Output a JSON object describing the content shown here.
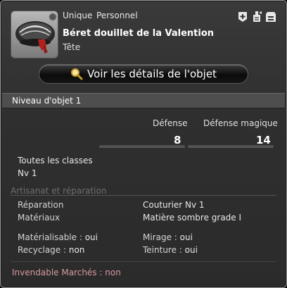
{
  "header": {
    "rarity": "Unique",
    "binding": "Personnel",
    "item_name": "Béret douillet de la Valention",
    "slot": "Tête",
    "top_icons": [
      "plus-icon",
      "crest-icon",
      "storage-icon"
    ]
  },
  "details_button": {
    "label": "Voir les détails de l'objet",
    "icon": "magnifier-icon"
  },
  "item_level": "Niveau d'objet 1",
  "stats": [
    {
      "label": "Défense",
      "value": "8"
    },
    {
      "label": "Défense magique",
      "value": "14"
    }
  ],
  "classes": "Toutes les classes",
  "level": "Nv 1",
  "crafting": {
    "title": "Artisanat et réparation",
    "repair_label": "Réparation",
    "repair_value": "Couturier Nv 1",
    "materials_label": "Matériaux",
    "materials_value": "Matière sombre grade I",
    "materialize_label": "Matérialisable : ",
    "materialize_value": "oui",
    "mirage_label": "Mirage : ",
    "mirage_value": "oui",
    "recycle_label": "Recyclage : ",
    "recycle_value": "non",
    "dye_label": "Teinture : ",
    "dye_value": "oui"
  },
  "market": "Invendable Marchés : non",
  "colors": {
    "market_text": "#d89aa0",
    "section_title": "#6f6f6f"
  }
}
